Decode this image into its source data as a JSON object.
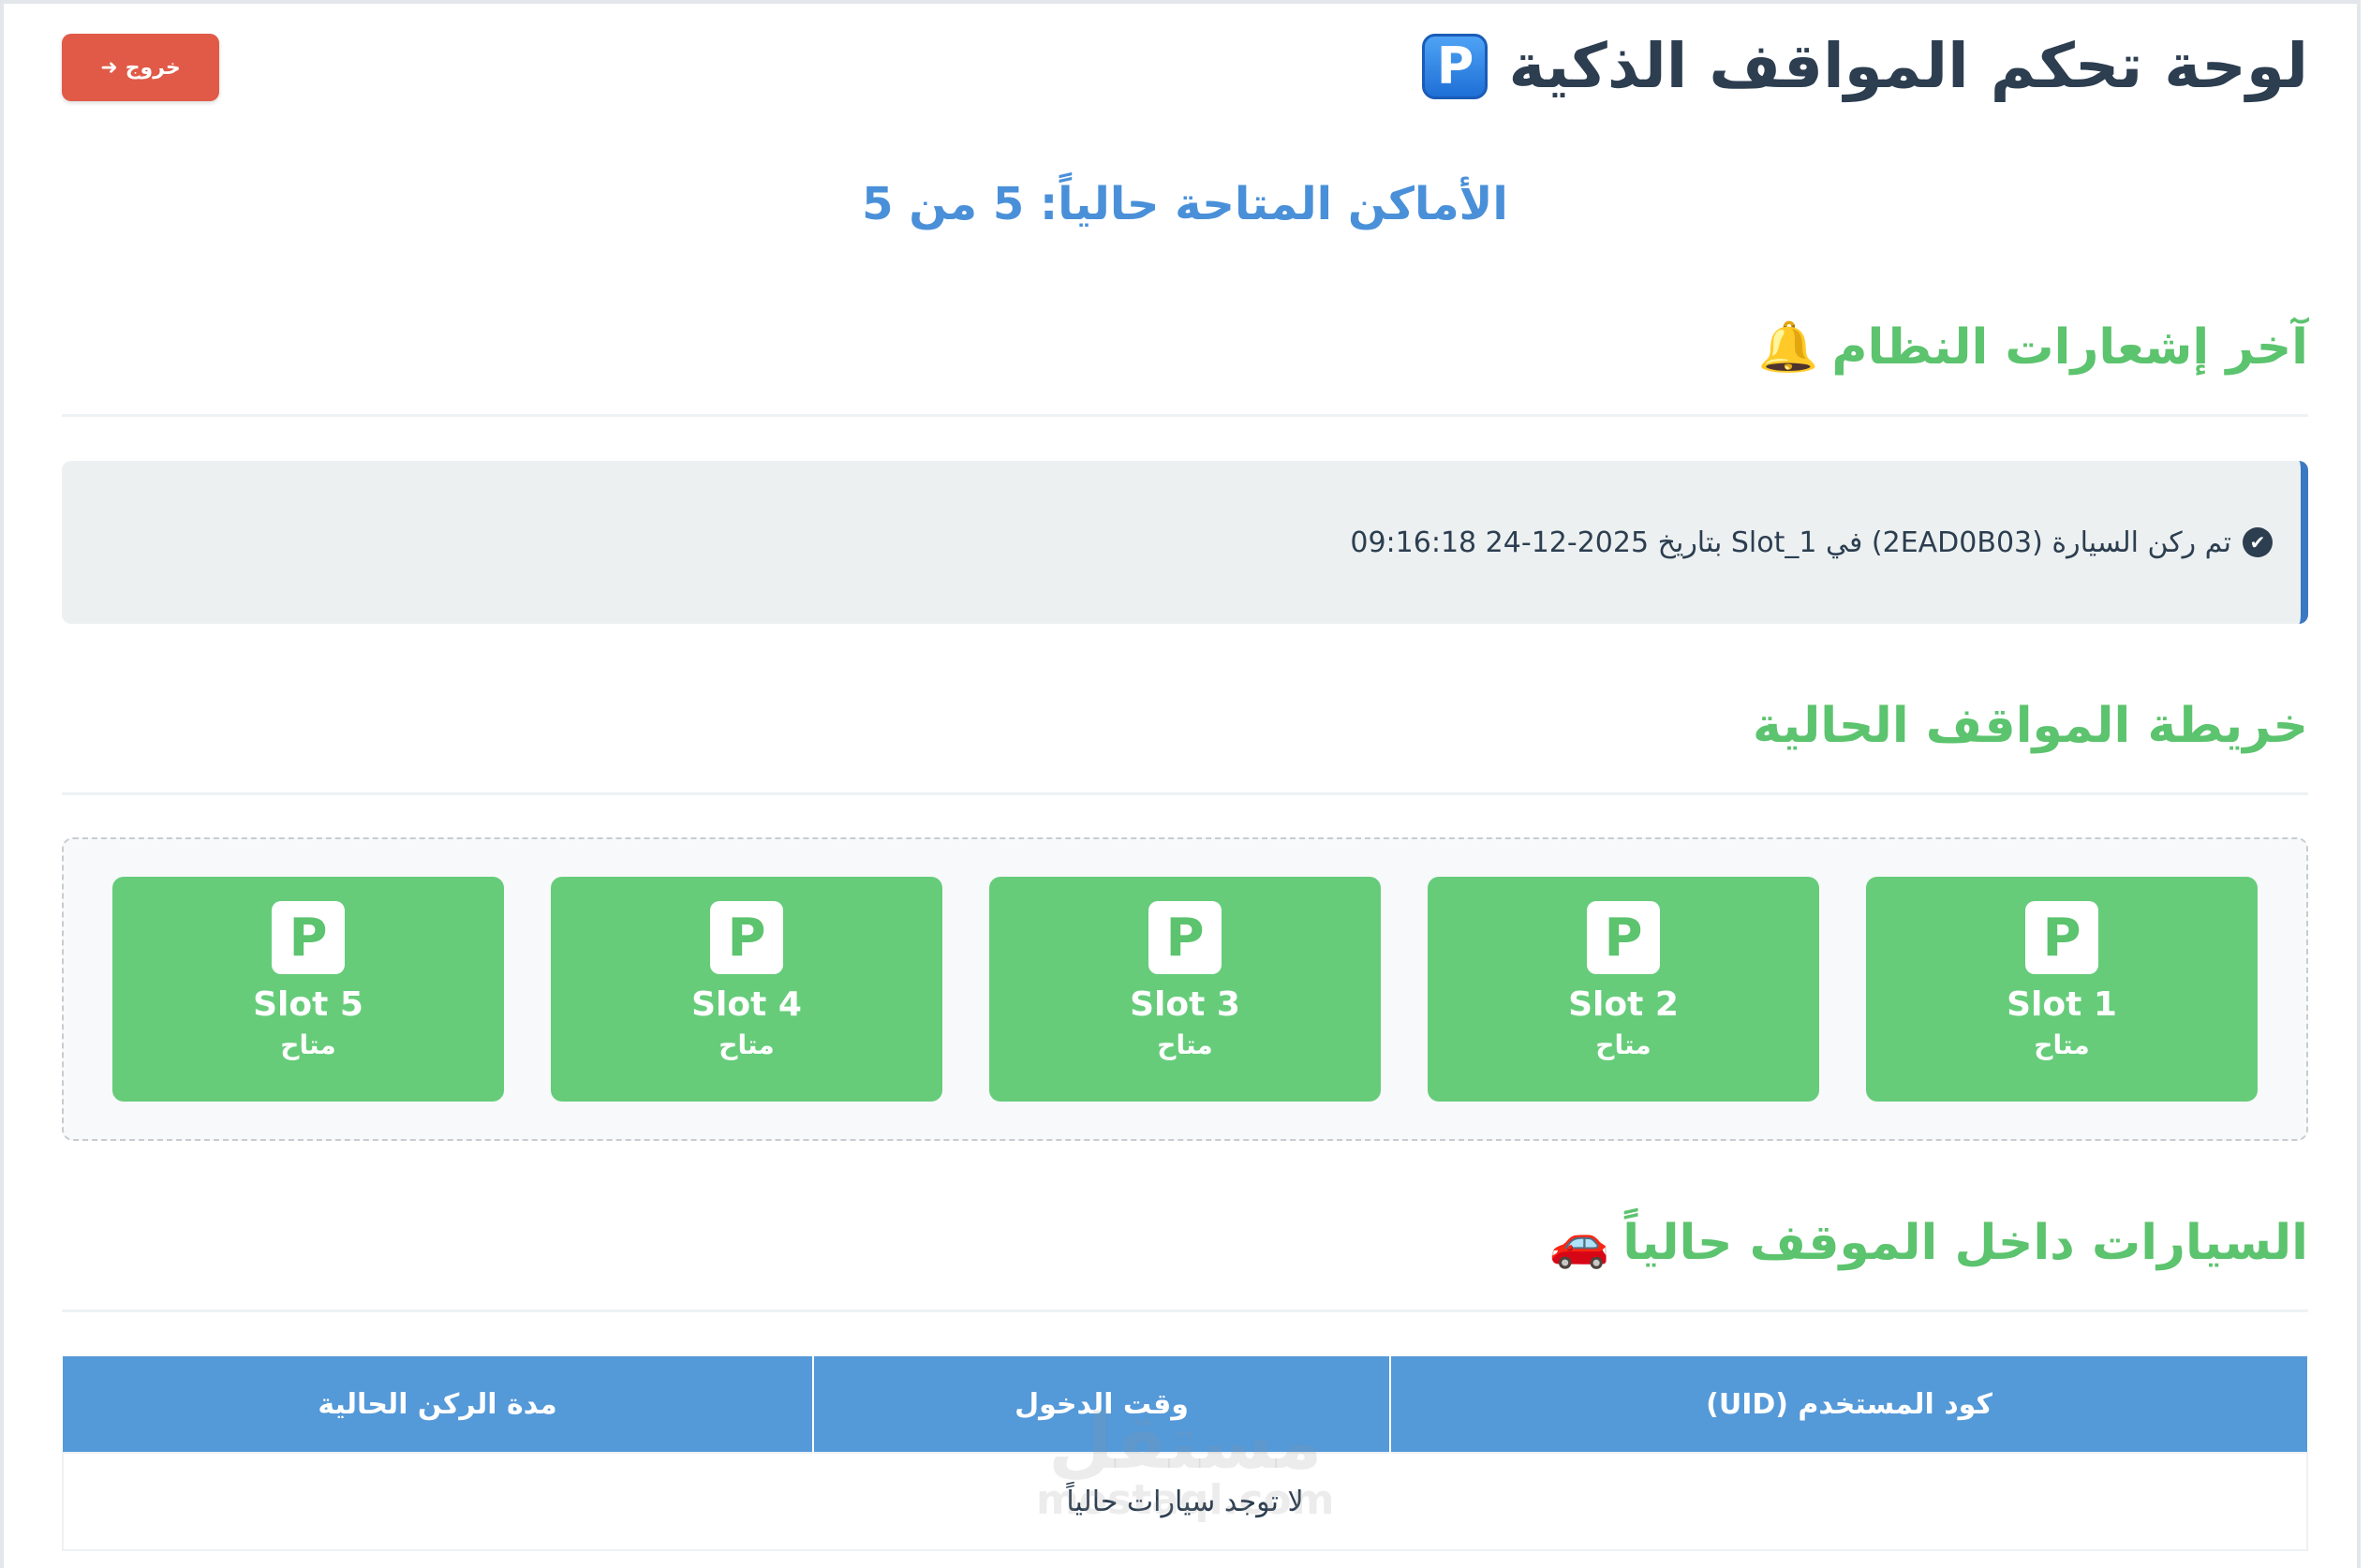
{
  "header": {
    "title": "لوحة تحكم المواقف الذكية",
    "title_icon": "P",
    "logout_label": "خروج",
    "logout_icon": "➜"
  },
  "availability": {
    "text": "الأماكن المتاحة حالياً: 5 من 5"
  },
  "notifications": {
    "title": "آخر إشعارات النظام",
    "title_icon": "🔔",
    "items": [
      {
        "icon": "✔",
        "text": "تم ركن السيارة (2EAD0B03) في Slot_1 بتاريخ 2025-12-24 09:16:18"
      }
    ]
  },
  "map": {
    "title": "خريطة المواقف الحالية",
    "slots": [
      {
        "icon": "P",
        "name": "Slot 1",
        "status": "متاح"
      },
      {
        "icon": "P",
        "name": "Slot 2",
        "status": "متاح"
      },
      {
        "icon": "P",
        "name": "Slot 3",
        "status": "متاح"
      },
      {
        "icon": "P",
        "name": "Slot 4",
        "status": "متاح"
      },
      {
        "icon": "P",
        "name": "Slot 5",
        "status": "متاح"
      }
    ]
  },
  "cars": {
    "title": "السيارات داخل الموقف حالياً",
    "title_icon": "🚗",
    "columns": [
      "كود المستخدم (UID)",
      "وقت الدخول",
      "مدة الركن الحالية"
    ],
    "empty_text": "لا توجد سيارات حالياً"
  },
  "watermark": {
    "arabic": "مستقل",
    "latin": "mostaql.com"
  },
  "colors": {
    "title": "#2c3e50",
    "accent_blue": "#4a90d9",
    "section_green": "#5cc36e",
    "slot_green": "#66cc7a",
    "logout_red": "#e05a47",
    "table_header": "#5499d8"
  }
}
